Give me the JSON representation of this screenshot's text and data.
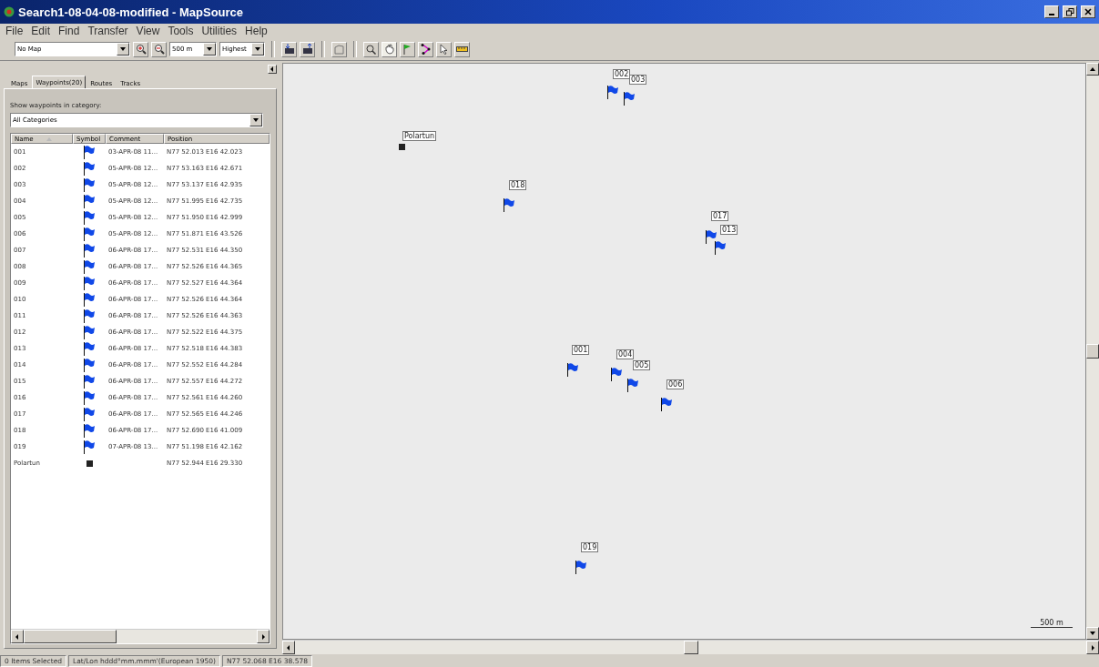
{
  "window": {
    "title": "Search1-08-04-08-modified - MapSource"
  },
  "menu": [
    "File",
    "Edit",
    "Find",
    "Transfer",
    "View",
    "Tools",
    "Utilities",
    "Help"
  ],
  "toolbar": {
    "map_select": "No Map",
    "zoom_select": "500 m",
    "detail_select": "Highest"
  },
  "tabs": [
    {
      "label": "Maps",
      "selected": false
    },
    {
      "label": "Waypoints(20)",
      "selected": true
    },
    {
      "label": "Routes",
      "selected": false
    },
    {
      "label": "Tracks",
      "selected": false
    }
  ],
  "category": {
    "label": "Show waypoints in category:",
    "value": "All Categories"
  },
  "table": {
    "columns": [
      "Name",
      "Symbol",
      "Comment",
      "Position"
    ],
    "rows": [
      {
        "name": "001",
        "kind": "flag",
        "comment": "03-APR-08 11...",
        "position": "N77 52.013 E16 42.023"
      },
      {
        "name": "002",
        "kind": "flag",
        "comment": "05-APR-08 12...",
        "position": "N77 53.163 E16 42.671"
      },
      {
        "name": "003",
        "kind": "flag",
        "comment": "05-APR-08 12...",
        "position": "N77 53.137 E16 42.935"
      },
      {
        "name": "004",
        "kind": "flag",
        "comment": "05-APR-08 12...",
        "position": "N77 51.995 E16 42.735"
      },
      {
        "name": "005",
        "kind": "flag",
        "comment": "05-APR-08 12...",
        "position": "N77 51.950 E16 42.999"
      },
      {
        "name": "006",
        "kind": "flag",
        "comment": "05-APR-08 12...",
        "position": "N77 51.871 E16 43.526"
      },
      {
        "name": "007",
        "kind": "flag",
        "comment": "06-APR-08 17...",
        "position": "N77 52.531 E16 44.350"
      },
      {
        "name": "008",
        "kind": "flag",
        "comment": "06-APR-08 17...",
        "position": "N77 52.526 E16 44.365"
      },
      {
        "name": "009",
        "kind": "flag",
        "comment": "06-APR-08 17...",
        "position": "N77 52.527 E16 44.364"
      },
      {
        "name": "010",
        "kind": "flag",
        "comment": "06-APR-08 17...",
        "position": "N77 52.526 E16 44.364"
      },
      {
        "name": "011",
        "kind": "flag",
        "comment": "06-APR-08 17...",
        "position": "N77 52.526 E16 44.363"
      },
      {
        "name": "012",
        "kind": "flag",
        "comment": "06-APR-08 17...",
        "position": "N77 52.522 E16 44.375"
      },
      {
        "name": "013",
        "kind": "flag",
        "comment": "06-APR-08 17...",
        "position": "N77 52.518 E16 44.383"
      },
      {
        "name": "014",
        "kind": "flag",
        "comment": "06-APR-08 17...",
        "position": "N77 52.552 E16 44.284"
      },
      {
        "name": "015",
        "kind": "flag",
        "comment": "06-APR-08 17...",
        "position": "N77 52.557 E16 44.272"
      },
      {
        "name": "016",
        "kind": "flag",
        "comment": "06-APR-08 17...",
        "position": "N77 52.561 E16 44.260"
      },
      {
        "name": "017",
        "kind": "flag",
        "comment": "06-APR-08 17...",
        "position": "N77 52.565 E16 44.246"
      },
      {
        "name": "018",
        "kind": "flag",
        "comment": "06-APR-08 17...",
        "position": "N77 52.690 E16 41.009"
      },
      {
        "name": "019",
        "kind": "flag",
        "comment": "07-APR-08 13...",
        "position": "N77 51.198 E16 42.162"
      },
      {
        "name": "Polartun",
        "kind": "square",
        "position": "N77 52.944 E16 29.330"
      }
    ]
  },
  "map": {
    "markers": [
      {
        "label": "Polartun",
        "kind": "square"
      },
      {
        "label": "002",
        "kind": "flag"
      },
      {
        "label": "003",
        "kind": "flag"
      },
      {
        "label": "018",
        "kind": "flag"
      },
      {
        "label": "017",
        "kind": "flag"
      },
      {
        "label": "013",
        "kind": "flag"
      },
      {
        "label": "001",
        "kind": "flag"
      },
      {
        "label": "004",
        "kind": "flag"
      },
      {
        "label": "005",
        "kind": "flag"
      },
      {
        "label": "006",
        "kind": "flag"
      },
      {
        "label": "019",
        "kind": "flag"
      }
    ],
    "scale": "500 m"
  },
  "status_bar": [
    "0 Items Selected",
    "Lat/Lon hddd°mm.mmm'(European 1950)",
    "N77 52.068 E16 38.578"
  ]
}
